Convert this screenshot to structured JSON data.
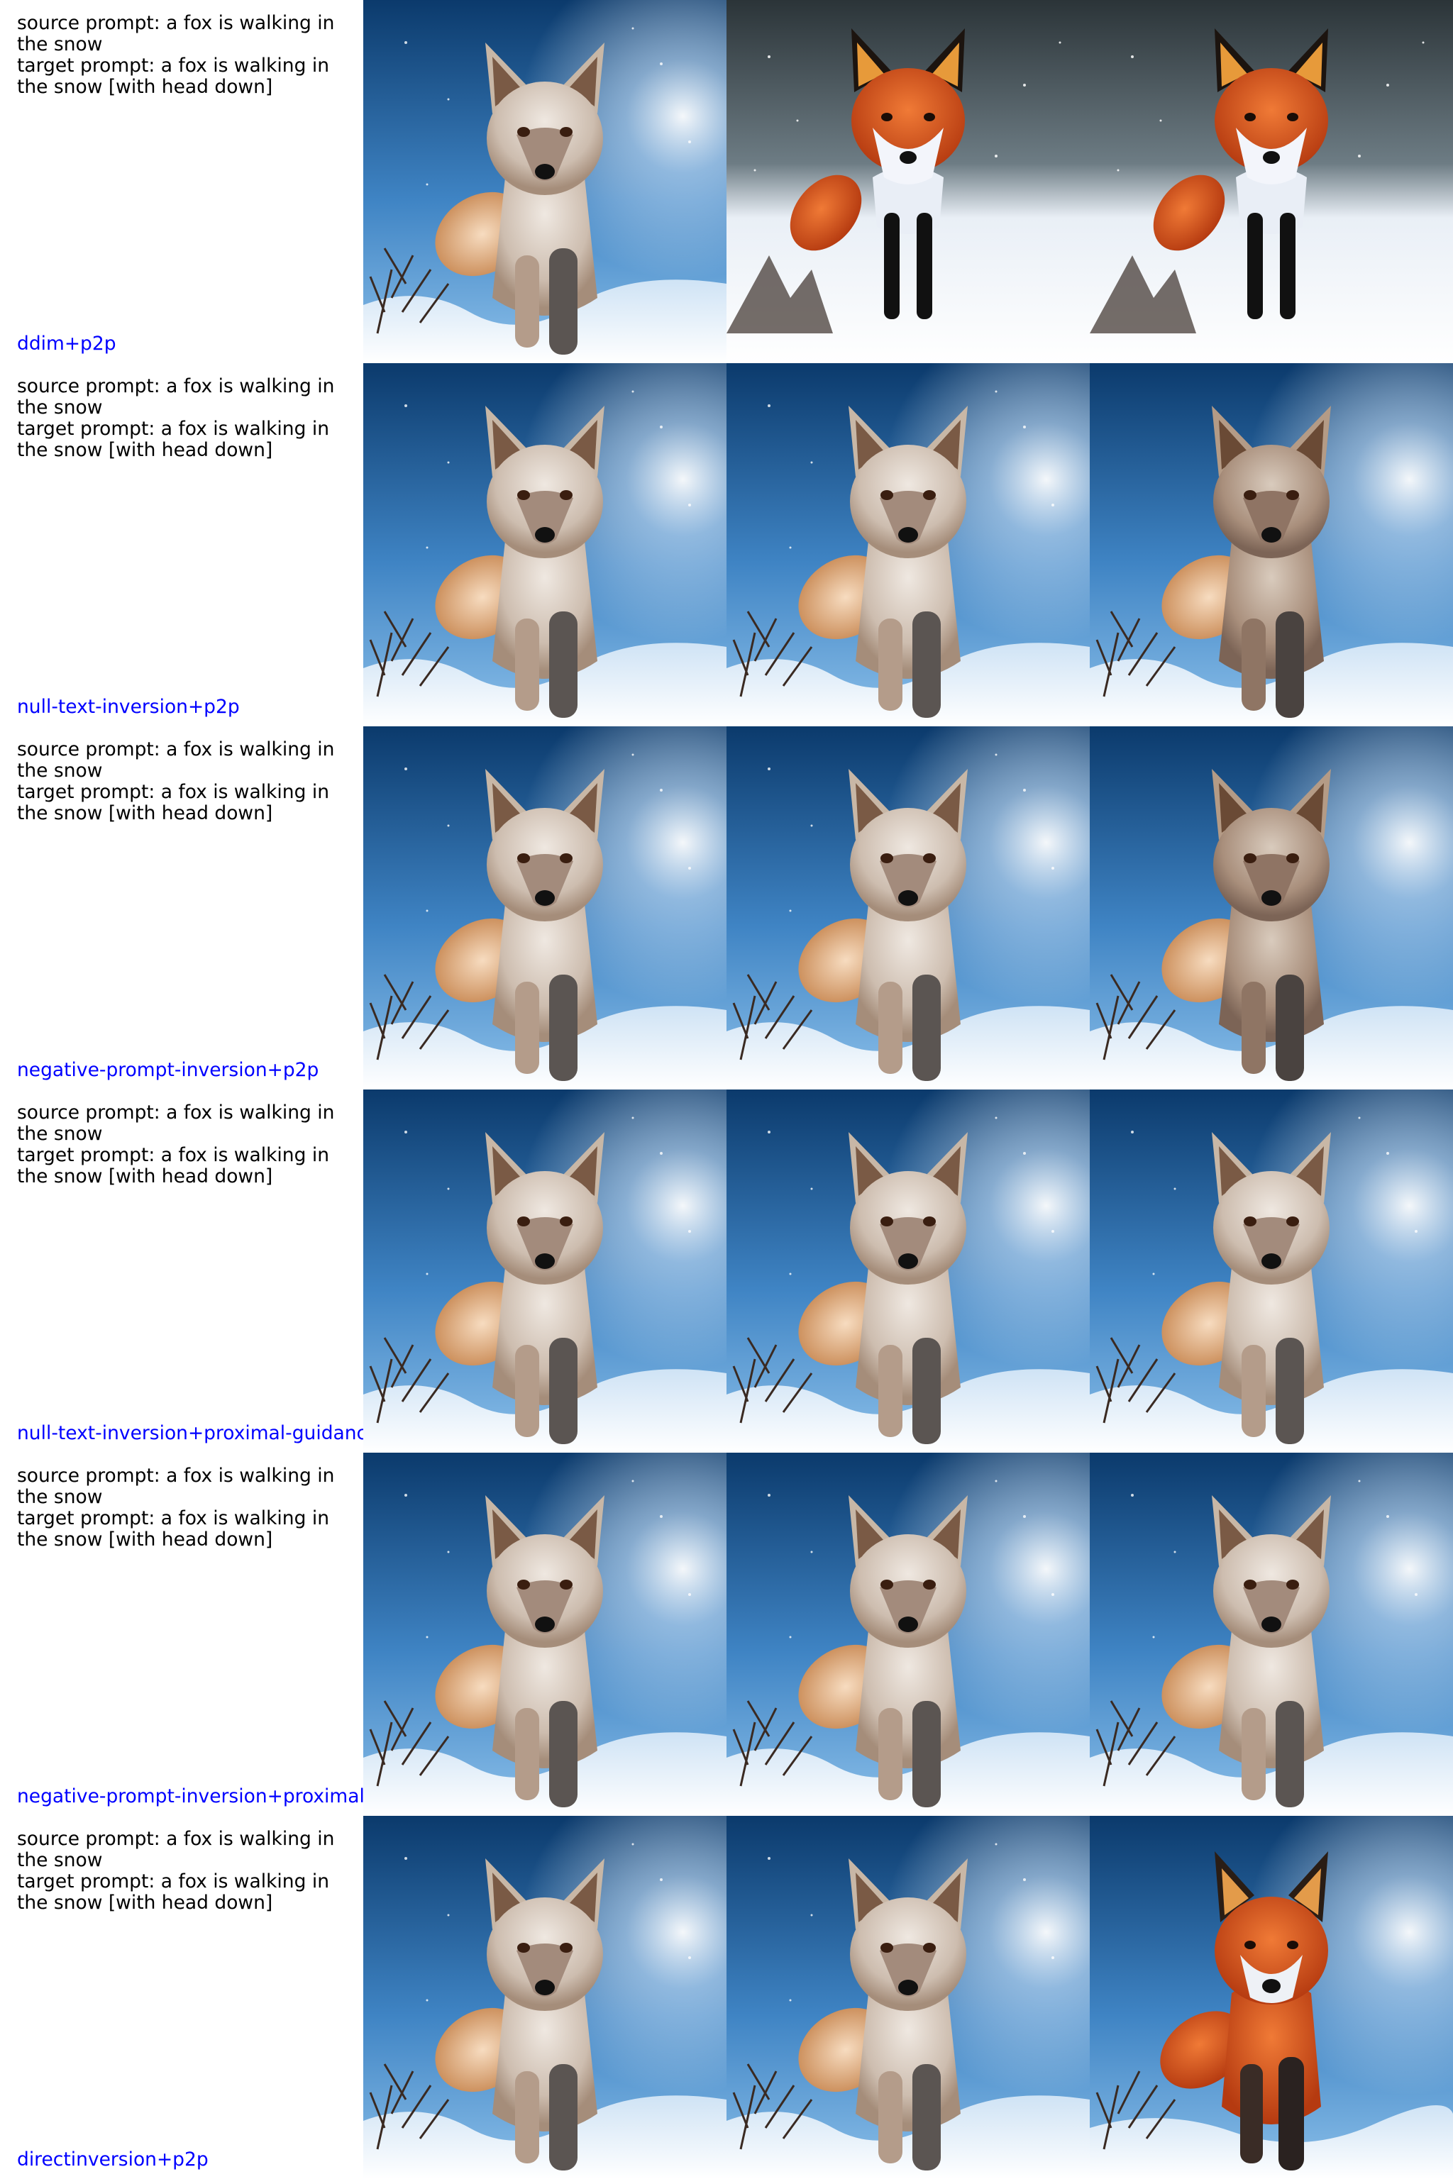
{
  "rows": [
    {
      "source_prompt": "source prompt: a fox is walking in the snow",
      "target_prompt": "target prompt: a fox is walking in the snow [with head down]",
      "method": "ddim+p2p",
      "images": [
        "grey-fox-source",
        "red-fox-edited",
        "red-fox-edited"
      ]
    },
    {
      "source_prompt": "source prompt: a fox is walking in the snow",
      "target_prompt": "target prompt: a fox is walking in the snow [with head down]",
      "method": "null-text-inversion+p2p",
      "images": [
        "grey-fox-source",
        "grey-fox-edited",
        "grey-fox-edited"
      ]
    },
    {
      "source_prompt": "source prompt: a fox is walking in the snow",
      "target_prompt": "target prompt: a fox is walking in the snow [with head down]",
      "method": "negative-prompt-inversion+p2p",
      "images": [
        "grey-fox-source",
        "grey-fox-edited",
        "grey-fox-edited"
      ]
    },
    {
      "source_prompt": "source prompt: a fox is walking in the snow",
      "target_prompt": "target prompt: a fox is walking in the snow [with head down]",
      "method": "null-text-inversion+proximal-guidance",
      "images": [
        "grey-fox-source",
        "grey-fox-edited",
        "grey-fox-edited"
      ]
    },
    {
      "source_prompt": "source prompt: a fox is walking in the snow",
      "target_prompt": "target prompt: a fox is walking in the snow [with head down]",
      "method": "negative-prompt-inversion+proximal-guidance",
      "images": [
        "grey-fox-source",
        "grey-fox-edited",
        "grey-fox-edited"
      ]
    },
    {
      "source_prompt": "source prompt: a fox is walking in the snow",
      "target_prompt": "target prompt: a fox is walking in the snow [with head down]",
      "method": "directinversion+p2p",
      "images": [
        "grey-fox-source",
        "grey-fox-edited",
        "red-fox-edited"
      ]
    }
  ],
  "palette": {
    "sky_top": "#0d3f72",
    "sky_bottom": "#5aa2dd",
    "snow": "#f2f6fb",
    "grey_fur": "#d9cfc6",
    "red_fur": "#d8501c",
    "method_text": "#0000ff"
  }
}
